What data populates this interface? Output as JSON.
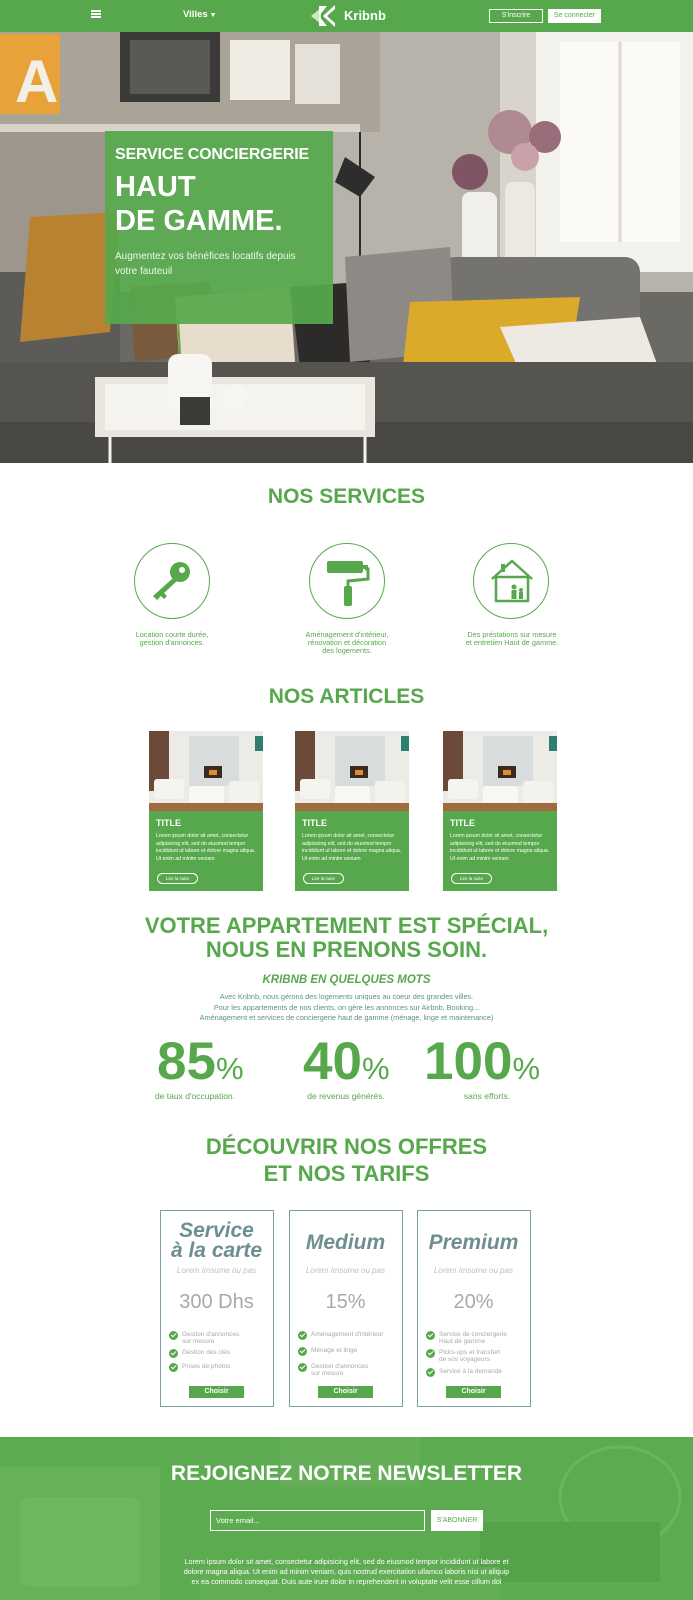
{
  "header": {
    "menu_icon": "hamburger-icon",
    "cities_label": "Villes",
    "brand": "Kribnb",
    "signup_label": "S'inscrire",
    "login_label": "Se connecter"
  },
  "hero": {
    "line1": "SERVICE CONCIERGERIE",
    "line2": "HAUT",
    "line3": "DE GAMME.",
    "subtitle_1": "Augmentez vos bénéfices locatifs depuis",
    "subtitle_2": "votre fauteuil"
  },
  "services": {
    "title": "NOS SERVICES",
    "items": [
      {
        "icon": "key-icon",
        "line1": "Location courte durée,",
        "line2": "gestion d'annonces.",
        "line3": ""
      },
      {
        "icon": "paint-roller-icon",
        "line1": "Aménagement d'intérieur,",
        "line2": "rénovation et décoration",
        "line3": "des logements."
      },
      {
        "icon": "house-icon",
        "line1": "Des préstations sur mesure",
        "line2": "et entretien Haut de gamme.",
        "line3": ""
      }
    ]
  },
  "articles": {
    "title": "NOS ARTICLES",
    "items": [
      {
        "title": "TITLE",
        "body": "Lorem ipsum dolor sit amet, consectetur adipisicing elit, sed do eiusmod tempor incididunt ut labore et dolore magna aliqua. Ut enim ad minim veniam",
        "button": "Lire la suite"
      },
      {
        "title": "TITLE",
        "body": "Lorem ipsum dolor sit amet, consectetur adipisicing elit, sed do eiusmod tempor incididunt ut labore et dolore magna aliqua. Ut enim ad minim veniam",
        "button": "Lire la suite"
      },
      {
        "title": "TITLE",
        "body": "Lorem ipsum dolor sit amet, consectetur adipisicing elit, sed do eiusmod tempor incididunt ut labore et dolore magna aliqua. Ut enim ad minim veniam",
        "button": "Lire la suite"
      }
    ]
  },
  "about": {
    "title_1": "VOTRE APPARTEMENT EST SPÉCIAL,",
    "title_2": "NOUS EN PRENONS SOIN.",
    "subtitle": "KRIBNB EN QUELQUES MOTS",
    "text_1": "Avec Kribnb, nous gérons des logements uniques au coeur des grandes villes.",
    "text_2": "Pour les appartements de nos clients, on gère les annonces sur Airbnb, Booking...",
    "text_3": "Aménagement et services de conciergerie haut de gamme (ménage, linge et maintenance)"
  },
  "stats": [
    {
      "value": "85",
      "unit": "%",
      "caption": "de taux d'occupation."
    },
    {
      "value": "40",
      "unit": "%",
      "caption": "de revenus générés."
    },
    {
      "value": "100",
      "unit": "%",
      "caption": "sans efforts."
    }
  ],
  "offers": {
    "title_1": "DÉCOUVRIR NOS OFFRES",
    "title_2": "ET NOS TARIFS",
    "plans": [
      {
        "name_1": "Service",
        "name_2": "à la carte",
        "sub": "Lorem imsume ou pas",
        "price": "300 Dhs",
        "features": [
          [
            "Gestion d'annonces",
            "sur mesure"
          ],
          [
            "Gestion des clés",
            ""
          ],
          [
            "Prises de photos",
            ""
          ]
        ],
        "button": "Choisir"
      },
      {
        "name_1": "Medium",
        "name_2": "",
        "sub": "Lorem imsume ou pas",
        "price": "15%",
        "features": [
          [
            "Aménagement d'intérieur",
            ""
          ],
          [
            "Ménage et linge",
            ""
          ],
          [
            "Gestion d'annonces",
            "sur mesure"
          ]
        ],
        "button": "Choisir"
      },
      {
        "name_1": "Premium",
        "name_2": "",
        "sub": "Lorem imsume ou pas",
        "price": "20%",
        "features": [
          [
            "Service de conciergerie",
            "Haut de gamme"
          ],
          [
            "Picks-ups et transfert",
            "de vos voyageurs"
          ],
          [
            "Service à la demande",
            ""
          ]
        ],
        "button": "Choisir"
      }
    ]
  },
  "newsletter": {
    "title": "REJOIGNEZ NOTRE NEWSLETTER",
    "placeholder": "Votre email...",
    "button": "S'ABONNER",
    "text_1": "Lorem ipsum dolor sit amet, consectetur adipisicing elit, sed do eiusmod tempor incididunt ut labore et",
    "text_2": "dolore magna aliqua. Ut enim ad minim veniam, quis nostrud exercitation ullamco laboris nisi ut aliquip",
    "text_3": "ex ea commodo consequat. Duis aute irure dolor in reprehenderit in voluptate velit esse cillum dol"
  },
  "colors": {
    "brand_green": "#57a84c",
    "pricing_border": "#7b9ea0"
  }
}
